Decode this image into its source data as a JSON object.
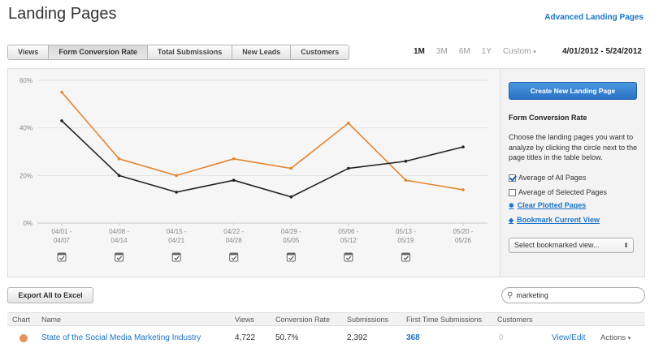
{
  "header": {
    "title": "Landing Pages",
    "advanced_link": "Advanced Landing Pages"
  },
  "tabs": [
    {
      "label": "Views",
      "active": false
    },
    {
      "label": "Form Conversion Rate",
      "active": true
    },
    {
      "label": "Total Submissions",
      "active": false
    },
    {
      "label": "New Leads",
      "active": false
    },
    {
      "label": "Customers",
      "active": false
    }
  ],
  "time_ranges": {
    "options": [
      "1M",
      "3M",
      "6M",
      "1Y"
    ],
    "active": "1M",
    "custom_label": "Custom",
    "date_range": "4/01/2012 - 5/24/2012"
  },
  "chart_data": {
    "type": "line",
    "categories": [
      "04/01 - 04/07",
      "04/08 - 04/14",
      "04/15 - 04/21",
      "04/22 - 04/28",
      "04/29 - 05/05",
      "05/06 - 05/12",
      "05/13 - 05/19",
      "05/20 - 05/26"
    ],
    "category_lines": [
      [
        "04/01 -",
        "04/07"
      ],
      [
        "04/08 -",
        "04/14"
      ],
      [
        "04/15 -",
        "04/21"
      ],
      [
        "04/22 -",
        "04/28"
      ],
      [
        "04/29 -",
        "05/05"
      ],
      [
        "05/06 -",
        "05/12"
      ],
      [
        "05/13 -",
        "05/19"
      ],
      [
        "05/20 -",
        "05/26"
      ]
    ],
    "series": [
      {
        "color": "#e2852f",
        "values": [
          55,
          27,
          20,
          27,
          23,
          42,
          18,
          14
        ]
      },
      {
        "color": "#222222",
        "values": [
          43,
          20,
          13,
          18,
          11,
          23,
          26,
          32
        ]
      }
    ],
    "ylim": [
      0,
      60
    ],
    "yticks": [
      0,
      20,
      40,
      60
    ],
    "ytick_labels": [
      "0%",
      "20%",
      "40%",
      "60%"
    ],
    "grid": true,
    "marker_icon": "calendar-icon",
    "marker_count": 7
  },
  "side": {
    "create_button": "Create New Landing Page",
    "heading": "Form Conversion Rate",
    "description": "Choose the landing pages you want to analyze by clicking the circle next to the page titles in the table below.",
    "options": [
      {
        "label": "Average of All Pages",
        "checked": true
      },
      {
        "label": "Average of Selected Pages",
        "checked": false
      }
    ],
    "clear_link": "Clear Plotted Pages",
    "clear_icon": "gear-icon",
    "bookmark_link": "Bookmark Current View",
    "bookmark_icon": "bookmark-icon",
    "bookmark_select": "Select bookmarked view..."
  },
  "toolbar": {
    "export_label": "Export All to Excel",
    "search_value": "marketing",
    "search_icon": "search-icon"
  },
  "table": {
    "columns": [
      "Chart",
      "Name",
      "Views",
      "Conversion Rate",
      "Submissions",
      "First Time Submissions",
      "Customers"
    ],
    "rows": [
      {
        "dot_color": "#e2925a",
        "name": "State of the Social Media Marketing Industry",
        "views": "4,722",
        "conversion_rate": "50.7%",
        "submissions": "2,392",
        "first_time_submissions": "368",
        "customers": "0",
        "view_edit": "View/Edit",
        "actions": "Actions"
      }
    ]
  }
}
